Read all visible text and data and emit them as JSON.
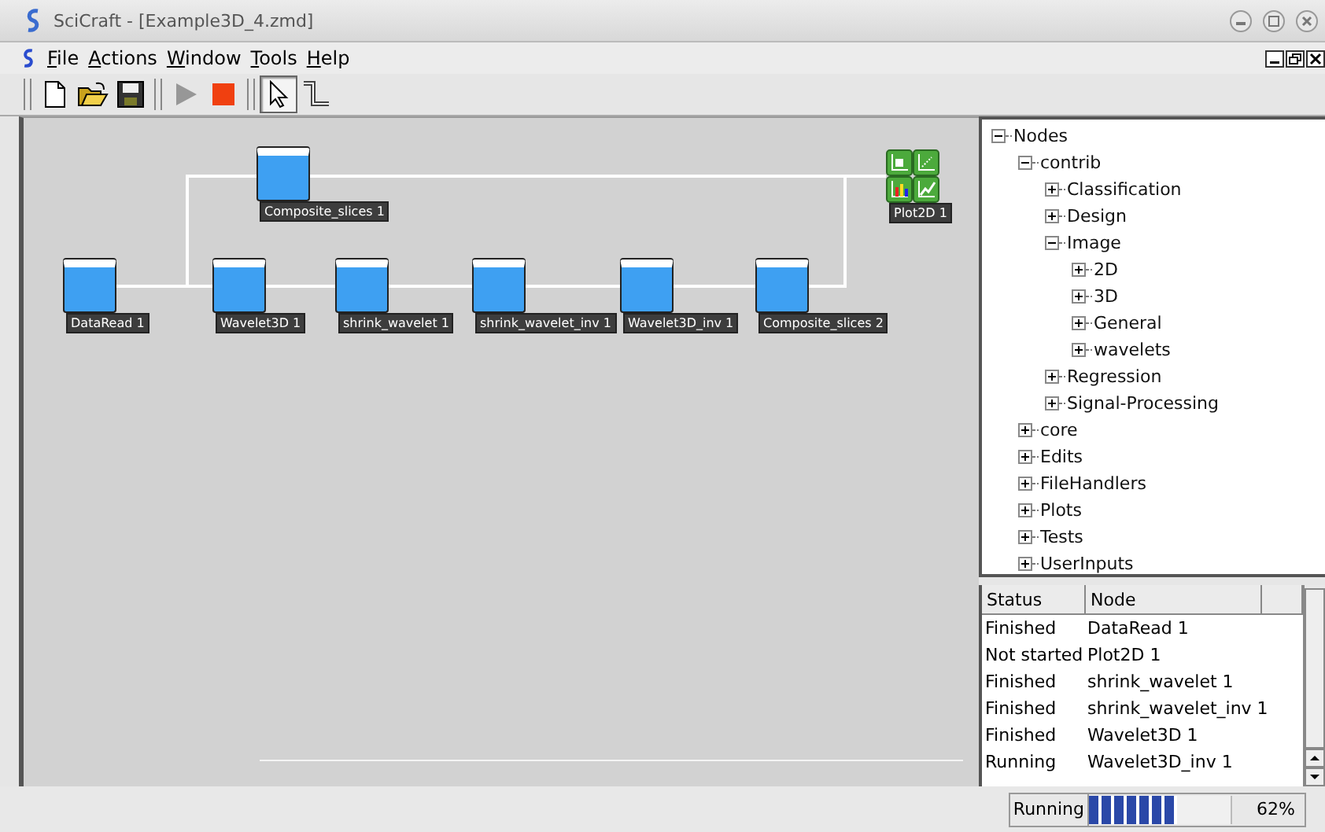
{
  "window": {
    "title": "SciCraft - [Example3D_4.zmd]"
  },
  "menu": [
    {
      "label": "File"
    },
    {
      "label": "Actions"
    },
    {
      "label": "Window"
    },
    {
      "label": "Tools"
    },
    {
      "label": "Help"
    }
  ],
  "toolbar": [
    {
      "kind": "new",
      "disabled": false,
      "selected": false
    },
    {
      "kind": "open",
      "disabled": false,
      "selected": false
    },
    {
      "kind": "save",
      "disabled": false,
      "selected": false
    },
    {
      "kind": "run",
      "disabled": true,
      "selected": false
    },
    {
      "kind": "stop",
      "disabled": false,
      "selected": false
    },
    {
      "kind": "pointer",
      "disabled": false,
      "selected": true
    },
    {
      "kind": "connector",
      "disabled": false,
      "selected": false
    }
  ],
  "canvas": {
    "nodes": [
      {
        "kind": "module",
        "label": "Composite_slices 1"
      },
      {
        "kind": "module",
        "label": "DataRead 1"
      },
      {
        "kind": "module",
        "label": "Wavelet3D 1"
      },
      {
        "kind": "module",
        "label": "shrink_wavelet 1"
      },
      {
        "kind": "module",
        "label": "shrink_wavelet_inv 1"
      },
      {
        "kind": "module",
        "label": "Wavelet3D_inv 1"
      },
      {
        "kind": "module",
        "label": "Composite_slices 2"
      },
      {
        "kind": "plot",
        "label": "Plot2D 1"
      }
    ]
  },
  "tree": [
    {
      "label": "Nodes",
      "expanded": true,
      "children": [
        {
          "label": "contrib",
          "expanded": true,
          "children": [
            {
              "label": "Classification",
              "expanded": false
            },
            {
              "label": "Design",
              "expanded": false
            },
            {
              "label": "Image",
              "expanded": true,
              "children": [
                {
                  "label": "2D",
                  "expanded": false
                },
                {
                  "label": "3D",
                  "expanded": false
                },
                {
                  "label": "General",
                  "expanded": false
                },
                {
                  "label": "wavelets",
                  "expanded": false
                }
              ]
            },
            {
              "label": "Regression",
              "expanded": false
            },
            {
              "label": "Signal-Processing",
              "expanded": false
            }
          ]
        },
        {
          "label": "core",
          "expanded": false
        },
        {
          "label": "Edits",
          "expanded": false
        },
        {
          "label": "FileHandlers",
          "expanded": false
        },
        {
          "label": "Plots",
          "expanded": false
        },
        {
          "label": "Tests",
          "expanded": false
        },
        {
          "label": "UserInputs",
          "expanded": false
        }
      ]
    }
  ],
  "status_table": {
    "columns": [
      "Status",
      "Node"
    ],
    "rows": [
      {
        "status": "Finished",
        "node": "DataRead 1"
      },
      {
        "status": "Not started",
        "node": "Plot2D 1"
      },
      {
        "status": "Finished",
        "node": "shrink_wavelet 1"
      },
      {
        "status": "Finished",
        "node": "shrink_wavelet_inv 1"
      },
      {
        "status": "Finished",
        "node": "Wavelet3D 1"
      },
      {
        "status": "Running",
        "node": "Wavelet3D_inv 1"
      }
    ]
  },
  "status_bar": {
    "label": "Running",
    "level": 0.62,
    "reading": "62%"
  }
}
